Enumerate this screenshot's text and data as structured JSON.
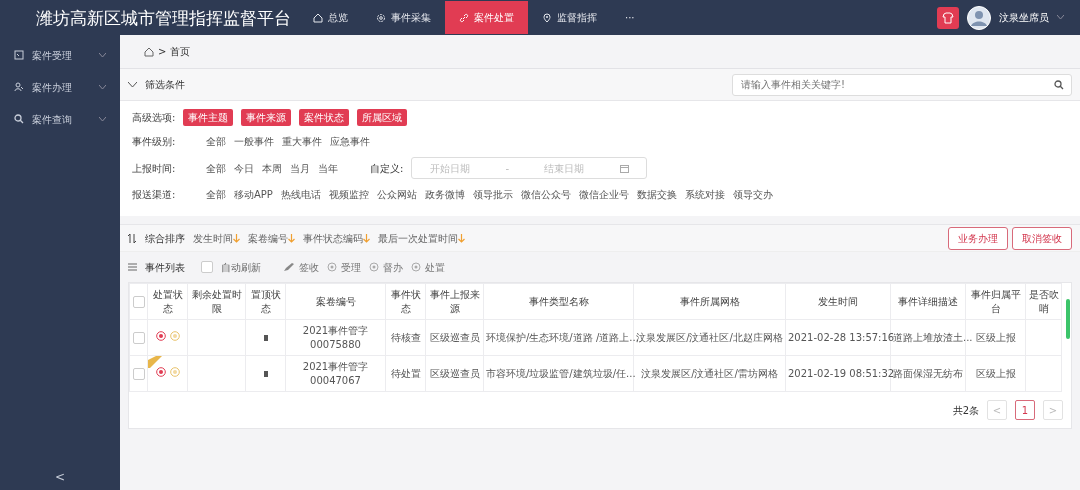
{
  "header": {
    "title": "潍坊高新区城市管理指挥监督平台",
    "nav": [
      {
        "label": "总览",
        "selected": false
      },
      {
        "label": "事件采集",
        "selected": false
      },
      {
        "label": "案件处置",
        "selected": true
      },
      {
        "label": "监督指挥",
        "selected": false
      },
      {
        "label": "···",
        "selected": false
      }
    ],
    "user": "汶泉坐席员"
  },
  "sidebar": {
    "items": [
      {
        "label": "案件受理"
      },
      {
        "label": "案件办理"
      },
      {
        "label": "案件查询"
      }
    ],
    "collapse": "<"
  },
  "breadcrumb": {
    "separator": ">",
    "items": [
      "首页"
    ]
  },
  "filter": {
    "title": "筛选条件",
    "search_placeholder": "请输入事件相关关键字!",
    "advanced": {
      "label": "高级选项:",
      "tags": [
        "事件主题",
        "事件来源",
        "案件状态",
        "所属区域"
      ]
    },
    "rows": [
      {
        "label": "事件级别:",
        "options": [
          "全部",
          "一般事件",
          "重大事件",
          "应急事件"
        ]
      },
      {
        "label": "上报时间:",
        "options": [
          "全部",
          "今日",
          "本周",
          "当月",
          "当年"
        ],
        "custom": {
          "label": "自定义:",
          "start_placeholder": "开始日期",
          "separator": "-",
          "end_placeholder": "结束日期"
        }
      },
      {
        "label": "报送渠道:",
        "options": [
          "全部",
          "移动APP",
          "热线电话",
          "视频监控",
          "公众网站",
          "政务微博",
          "领导批示",
          "微信公众号",
          "微信企业号",
          "数据交换",
          "系统对接",
          "领导交办"
        ]
      }
    ]
  },
  "sort": {
    "label": "综合排序",
    "fields": [
      "发生时间",
      "案卷编号",
      "事件状态编码",
      "最后一次处置时间"
    ]
  },
  "actions": [
    "业务办理",
    "取消签收"
  ],
  "list": {
    "title": "事件列表",
    "auto_refresh": {
      "label": "自动刷新",
      "checked": false
    },
    "tools": [
      {
        "label": "签收"
      },
      {
        "label": "受理"
      },
      {
        "label": "督办"
      },
      {
        "label": "处置"
      }
    ]
  },
  "table": {
    "header_checked": false,
    "columns": [
      "处置状态",
      "剩余处置时限",
      "置顶状态",
      "案卷编号",
      "事件状态",
      "事件上报来源",
      "事件类型名称",
      "事件所属网格",
      "发生时间",
      "事件详细描述",
      "事件归属平台",
      "是否吹哨"
    ],
    "rows": [
      {
        "checked": false,
        "flagged": false,
        "cells": [
          "",
          "",
          "",
          "2021事件管字00075880",
          "待核查",
          "区级巡查员",
          "环境保护/生态环境/道路 /道路上...",
          "汶泉发展区/汶通社区/北赵庄网格",
          "2021-02-28 13:57:16",
          "道路上堆放渣土...",
          "区级上报",
          ""
        ]
      },
      {
        "checked": false,
        "flagged": true,
        "cells": [
          "",
          "",
          "",
          "2021事件管字00047067",
          "待处置",
          "区级巡查员",
          "市容环境/垃圾监管/建筑垃圾/任...",
          "汶泉发展区/汶通社区/雷坊网格",
          "2021-02-19 08:51:32",
          "路面保湿无纺布",
          "区级上报",
          ""
        ]
      }
    ]
  },
  "pagination": {
    "total": "共2条",
    "prev": "<",
    "next": ">",
    "pages": [
      {
        "label": "1",
        "selected": true
      }
    ]
  }
}
